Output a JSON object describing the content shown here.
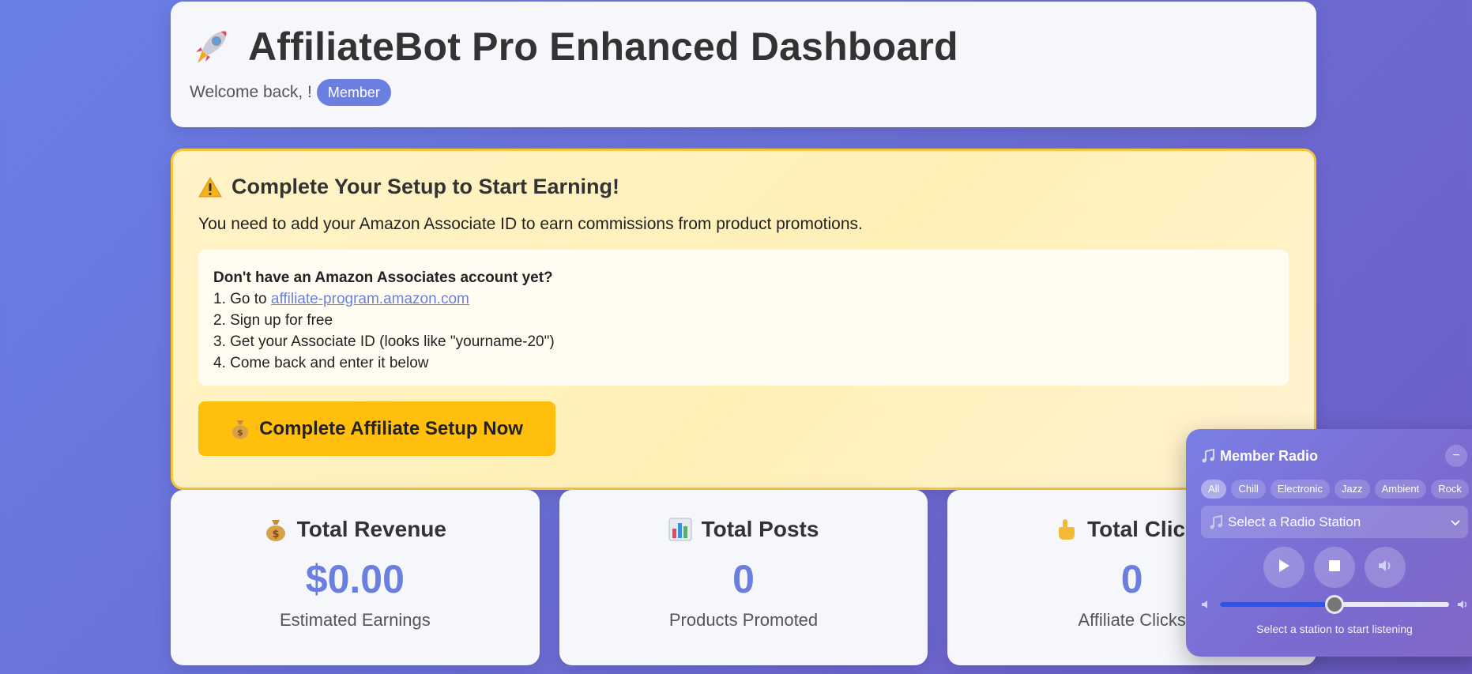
{
  "header": {
    "title": "AffiliateBot Pro Enhanced Dashboard",
    "welcome": "Welcome back, !",
    "badge": "Member",
    "icon": "rocket-icon"
  },
  "setup": {
    "title": "Complete Your Setup to Start Earning!",
    "description": "You need to add your Amazon Associate ID to earn commissions from product promotions.",
    "instructions_heading": "Don't have an Amazon Associates account yet?",
    "step1_prefix": "1. Go to ",
    "step1_link": "affiliate-program.amazon.com",
    "step2": "2. Sign up for free",
    "step3": "3. Get your Associate ID (looks like \"yourname-20\")",
    "step4": "4. Come back and enter it below",
    "button_label": "Complete Affiliate Setup Now",
    "colors": {
      "accent": "#ffbf0c",
      "border": "#f7c53a"
    }
  },
  "stats": [
    {
      "title": "Total Revenue",
      "value": "$0.00",
      "label": "Estimated Earnings",
      "icon": "money-bag-icon"
    },
    {
      "title": "Total Posts",
      "value": "0",
      "label": "Products Promoted",
      "icon": "bar-chart-icon"
    },
    {
      "title": "Total Clicks",
      "value": "0",
      "label": "Affiliate Clicks",
      "icon": "pointing-hand-icon"
    }
  ],
  "radio": {
    "title": "Member Radio",
    "minimize": "−",
    "genres": [
      "All",
      "Chill",
      "Electronic",
      "Jazz",
      "Ambient",
      "Rock"
    ],
    "active_genre": "All",
    "station_placeholder": "Select a Radio Station",
    "status": "Select a station to start listening",
    "volume": 0.5
  },
  "colors": {
    "brand": "#6b7fe0",
    "background_start": "#6a7fe8",
    "background_end": "#6d5cc6"
  }
}
